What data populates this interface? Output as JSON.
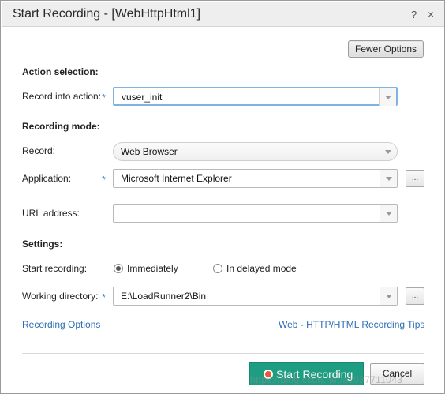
{
  "window": {
    "title": "Start Recording - [WebHttpHtml1]",
    "help_label": "?",
    "close_label": "×"
  },
  "fewer_options_label": "Fewer Options",
  "action_selection": {
    "heading": "Action selection:",
    "record_into_label": "Record into action:",
    "record_into_value": "vuser_init"
  },
  "recording_mode": {
    "heading": "Recording mode:",
    "record_label": "Record:",
    "record_value": "Web Browser",
    "application_label": "Application:",
    "application_value": "Microsoft Internet Explorer",
    "url_label": "URL address:",
    "url_value": ""
  },
  "settings": {
    "heading": "Settings:",
    "start_label": "Start recording:",
    "immediately_label": "Immediately",
    "delayed_label": "In delayed mode",
    "start_mode": "Immediately",
    "workdir_label": "Working directory:",
    "workdir_value": "E:\\LoadRunner2\\Bin"
  },
  "required_marker": "*",
  "browse_label": "...",
  "links": {
    "recording_options": "Recording Options",
    "recording_tips": "Web - HTTP/HTML Recording Tips"
  },
  "footer": {
    "start_label": "Start Recording",
    "cancel_label": "Cancel"
  },
  "watermark": "https://blog.csdn.net/a1037711043",
  "colors": {
    "accent_green": "#1f9d83",
    "link_blue": "#2e6fb5",
    "required_blue": "#4a86c8",
    "record_dot": "#e65a3a"
  }
}
